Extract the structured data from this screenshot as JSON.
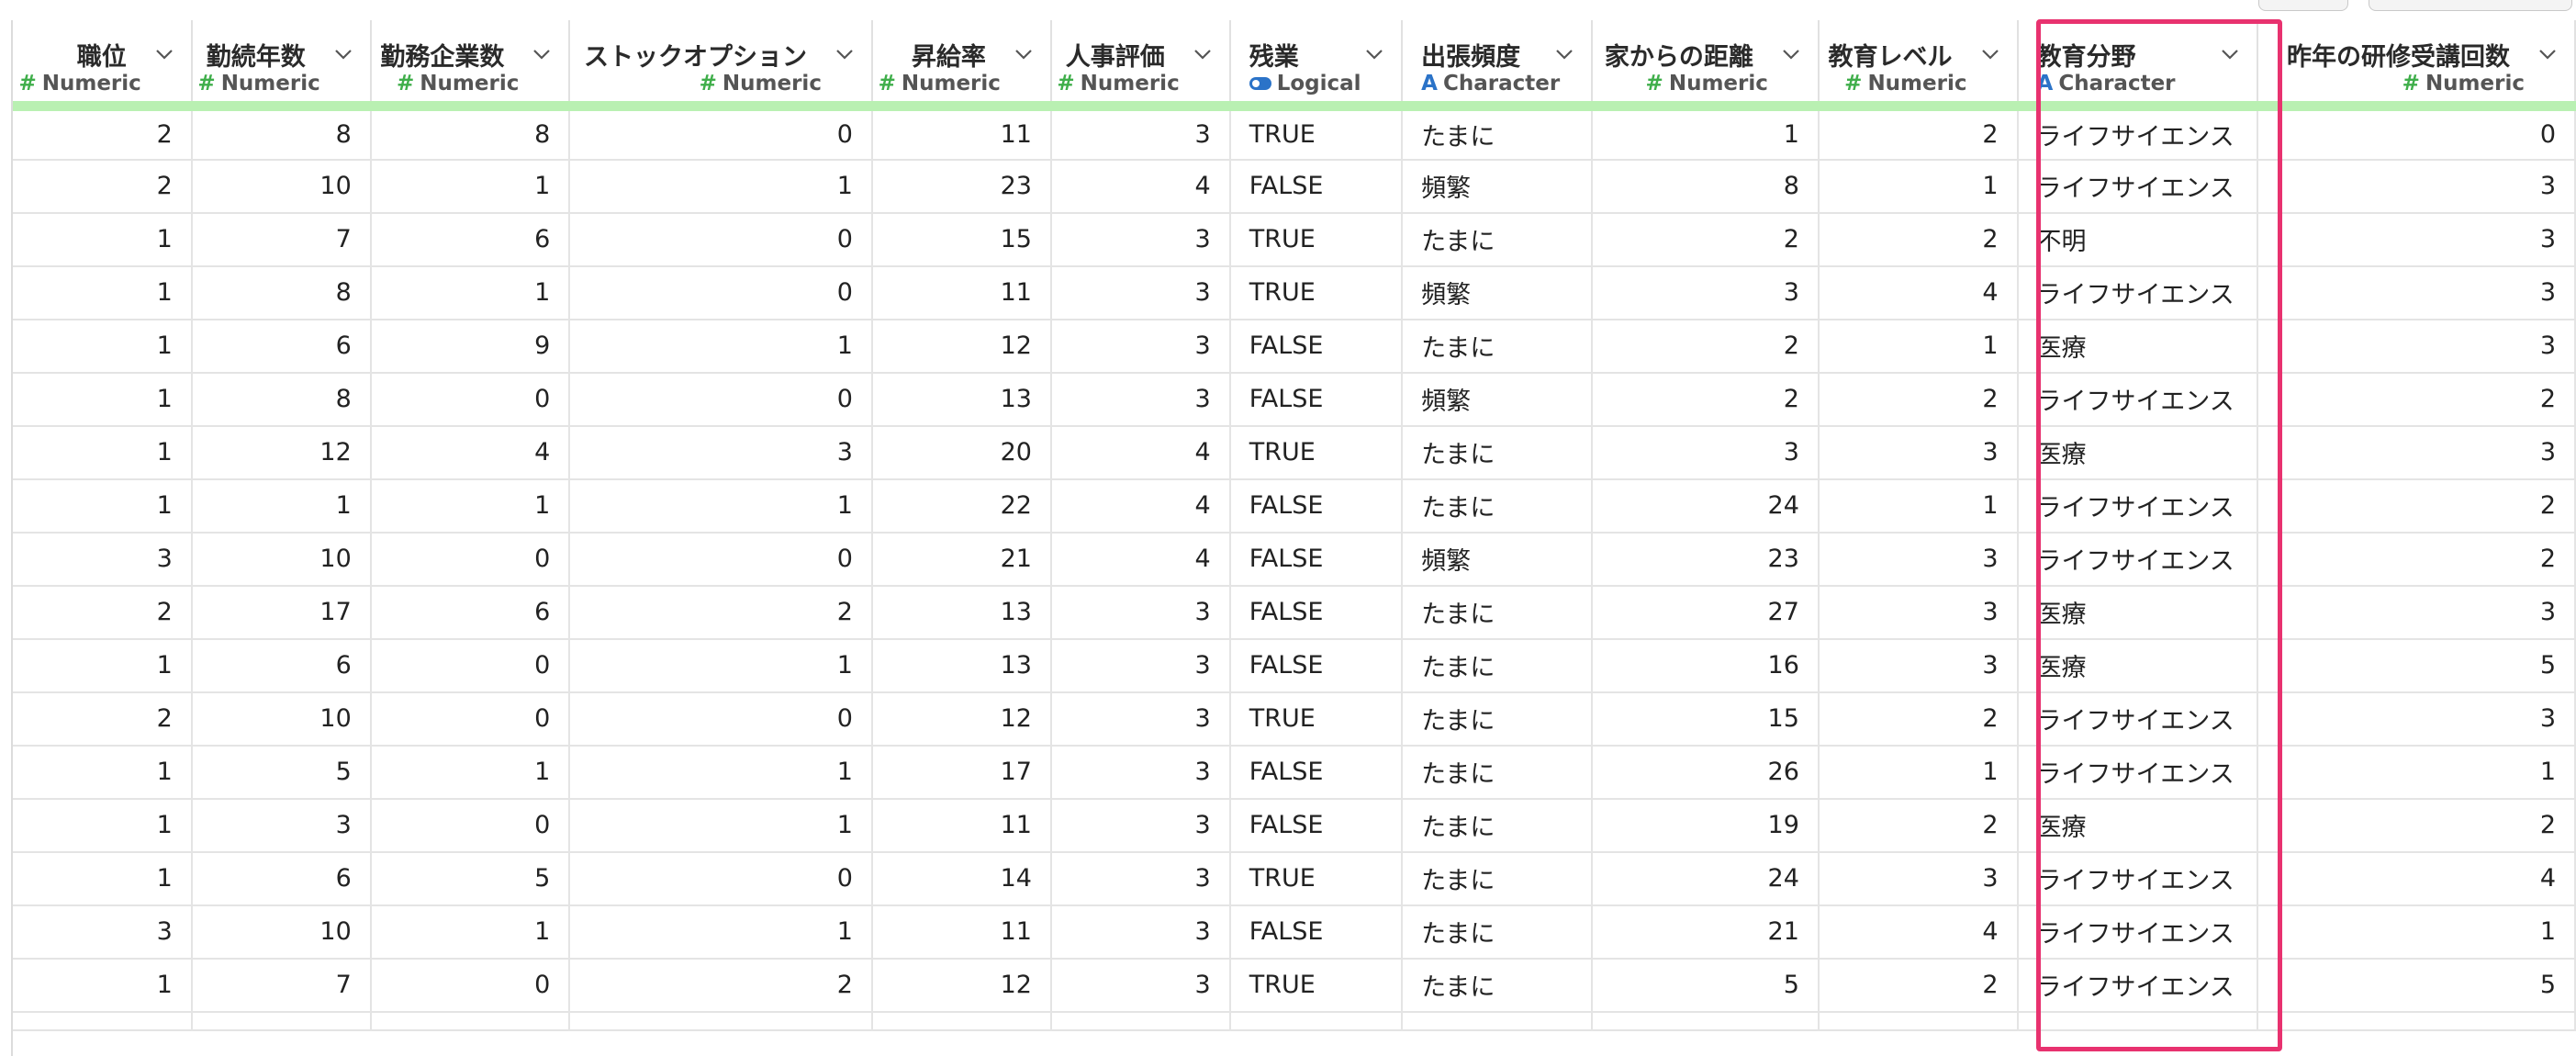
{
  "columns": [
    {
      "name": "職位",
      "type": "Numeric",
      "icon": "numeric-icon",
      "align": "num"
    },
    {
      "name": "勤続年数",
      "type": "Numeric",
      "icon": "numeric-icon",
      "align": "num"
    },
    {
      "name": "勤務企業数",
      "type": "Numeric",
      "icon": "numeric-icon",
      "align": "num"
    },
    {
      "name": "ストックオプション",
      "type": "Numeric",
      "icon": "numeric-icon",
      "align": "num"
    },
    {
      "name": "昇給率",
      "type": "Numeric",
      "icon": "numeric-icon",
      "align": "num"
    },
    {
      "name": "人事評価",
      "type": "Numeric",
      "icon": "numeric-icon",
      "align": "num"
    },
    {
      "name": "残業",
      "type": "Logical",
      "icon": "logical-icon",
      "align": "txt"
    },
    {
      "name": "出張頻度",
      "type": "Character",
      "icon": "character-icon",
      "align": "txt"
    },
    {
      "name": "家からの距離",
      "type": "Numeric",
      "icon": "numeric-icon",
      "align": "num"
    },
    {
      "name": "教育レベル",
      "type": "Numeric",
      "icon": "numeric-icon",
      "align": "num"
    },
    {
      "name": "教育分野",
      "type": "Character",
      "icon": "character-icon",
      "align": "txt"
    },
    {
      "name": "昨年の研修受講回数",
      "type": "Numeric",
      "icon": "numeric-icon",
      "align": "num"
    }
  ],
  "rows": [
    [
      "2",
      "8",
      "8",
      "0",
      "11",
      "3",
      "TRUE",
      "たまに",
      "1",
      "2",
      "ライフサイエンス",
      "0"
    ],
    [
      "2",
      "10",
      "1",
      "1",
      "23",
      "4",
      "FALSE",
      "頻繁",
      "8",
      "1",
      "ライフサイエンス",
      "3"
    ],
    [
      "1",
      "7",
      "6",
      "0",
      "15",
      "3",
      "TRUE",
      "たまに",
      "2",
      "2",
      "不明",
      "3"
    ],
    [
      "1",
      "8",
      "1",
      "0",
      "11",
      "3",
      "TRUE",
      "頻繁",
      "3",
      "4",
      "ライフサイエンス",
      "3"
    ],
    [
      "1",
      "6",
      "9",
      "1",
      "12",
      "3",
      "FALSE",
      "たまに",
      "2",
      "1",
      "医療",
      "3"
    ],
    [
      "1",
      "8",
      "0",
      "0",
      "13",
      "3",
      "FALSE",
      "頻繁",
      "2",
      "2",
      "ライフサイエンス",
      "2"
    ],
    [
      "1",
      "12",
      "4",
      "3",
      "20",
      "4",
      "TRUE",
      "たまに",
      "3",
      "3",
      "医療",
      "3"
    ],
    [
      "1",
      "1",
      "1",
      "1",
      "22",
      "4",
      "FALSE",
      "たまに",
      "24",
      "1",
      "ライフサイエンス",
      "2"
    ],
    [
      "3",
      "10",
      "0",
      "0",
      "21",
      "4",
      "FALSE",
      "頻繁",
      "23",
      "3",
      "ライフサイエンス",
      "2"
    ],
    [
      "2",
      "17",
      "6",
      "2",
      "13",
      "3",
      "FALSE",
      "たまに",
      "27",
      "3",
      "医療",
      "3"
    ],
    [
      "1",
      "6",
      "0",
      "1",
      "13",
      "3",
      "FALSE",
      "たまに",
      "16",
      "3",
      "医療",
      "5"
    ],
    [
      "2",
      "10",
      "0",
      "0",
      "12",
      "3",
      "TRUE",
      "たまに",
      "15",
      "2",
      "ライフサイエンス",
      "3"
    ],
    [
      "1",
      "5",
      "1",
      "1",
      "17",
      "3",
      "FALSE",
      "たまに",
      "26",
      "1",
      "ライフサイエンス",
      "1"
    ],
    [
      "1",
      "3",
      "0",
      "1",
      "11",
      "3",
      "FALSE",
      "たまに",
      "19",
      "2",
      "医療",
      "2"
    ],
    [
      "1",
      "6",
      "5",
      "0",
      "14",
      "3",
      "TRUE",
      "たまに",
      "24",
      "3",
      "ライフサイエンス",
      "4"
    ],
    [
      "3",
      "10",
      "1",
      "1",
      "11",
      "3",
      "FALSE",
      "たまに",
      "21",
      "4",
      "ライフサイエンス",
      "1"
    ],
    [
      "1",
      "7",
      "0",
      "2",
      "12",
      "3",
      "TRUE",
      "たまに",
      "5",
      "2",
      "ライフサイエンス",
      "5"
    ]
  ],
  "highlighted_column": "教育分野",
  "colors": {
    "header_underline": "#b9f0b2",
    "highlight_border": "#e8326f",
    "numeric_icon": "#3fae4a",
    "character_icon": "#2b73c8"
  }
}
